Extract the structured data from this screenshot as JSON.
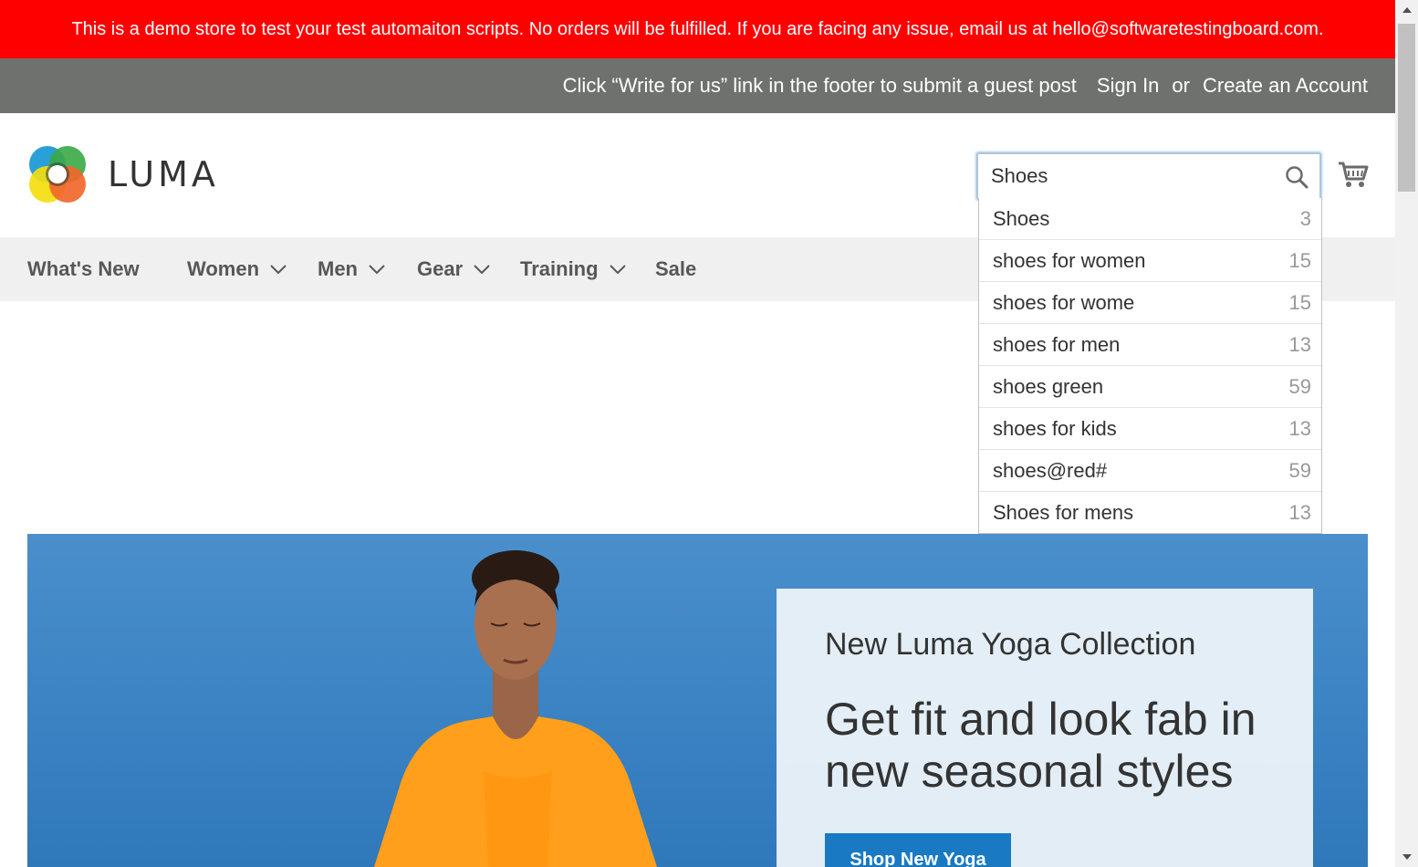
{
  "demo_notice": "This is a demo store to test your test automaiton scripts. No orders will be fulfilled. If you are facing any issue, email us at hello@softwaretestingboard.com.",
  "panel": {
    "promo": "Click “Write for us” link in the footer to submit a guest post",
    "sign_in": "Sign In",
    "or": "or",
    "create_account": "Create an Account"
  },
  "logo": {
    "text": "LUMA"
  },
  "search": {
    "value": "Shoes",
    "icon": "search-icon"
  },
  "cart": {
    "icon": "cart-icon"
  },
  "autocomplete": [
    {
      "term": "Shoes",
      "count": "3"
    },
    {
      "term": "shoes for women",
      "count": "15"
    },
    {
      "term": "shoes for wome",
      "count": "15"
    },
    {
      "term": "shoes for men",
      "count": "13"
    },
    {
      "term": "shoes green",
      "count": "59"
    },
    {
      "term": "shoes for kids",
      "count": "13"
    },
    {
      "term": "shoes@red#",
      "count": "59"
    },
    {
      "term": "Shoes for mens",
      "count": "13"
    }
  ],
  "nav": [
    {
      "label": "What's New"
    },
    {
      "label": "Women"
    },
    {
      "label": "Men"
    },
    {
      "label": "Gear"
    },
    {
      "label": "Training"
    },
    {
      "label": "Sale"
    }
  ],
  "hero": {
    "kicker": "New Luma Yoga Collection",
    "headline": "Get fit and look fab in new seasonal styles",
    "button": "Shop New Yoga"
  },
  "colors": {
    "demo_bar": "#fe0000",
    "panel_bar": "#6e716e",
    "nav_bg": "#f0f0f0",
    "primary_button": "#1979c3"
  }
}
